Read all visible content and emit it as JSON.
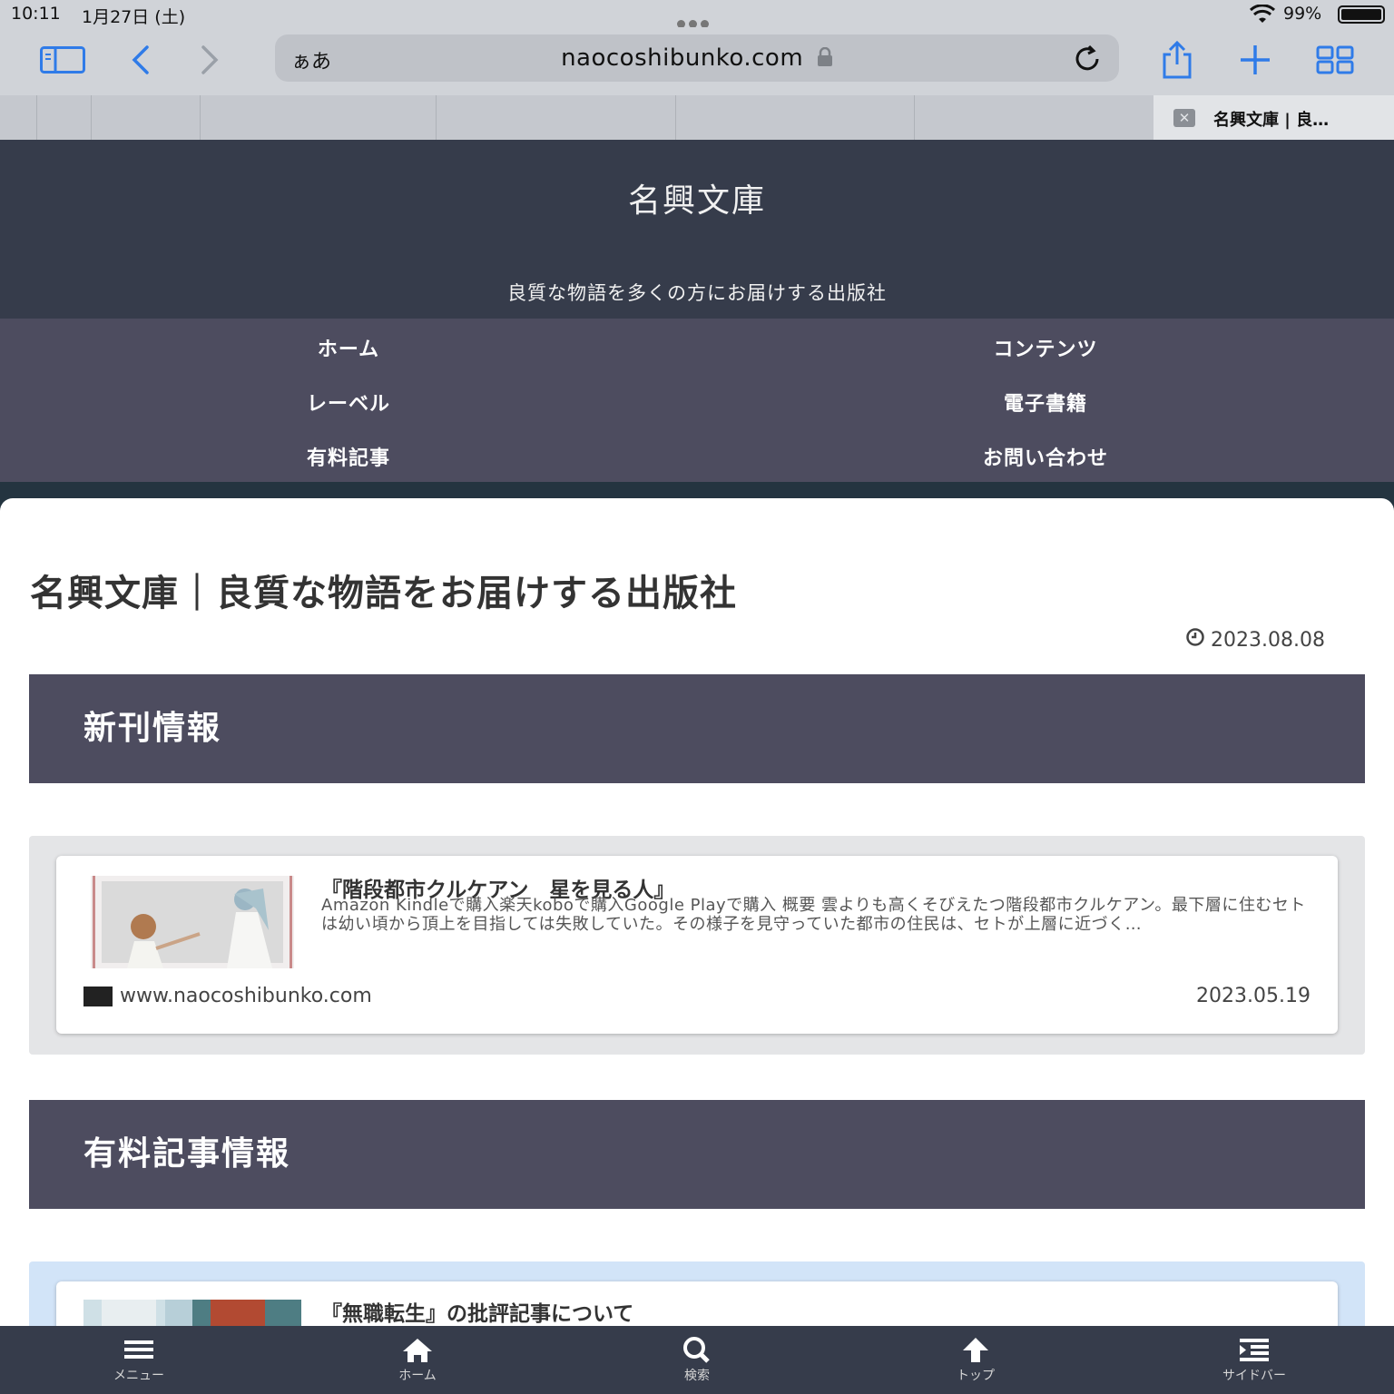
{
  "status_bar": {
    "time": "10:11",
    "date": "1月27日 (土)",
    "battery": "99%"
  },
  "browser": {
    "reader_label": "ぁあ",
    "url": "naocoshibunko.com",
    "tab_title": "名興文庫 | 良…"
  },
  "site": {
    "title": "名興文庫",
    "tagline": "良質な物語を多くの方にお届けする出版社",
    "nav": [
      "ホーム",
      "コンテンツ",
      "レーベル",
      "電子書籍",
      "有料記事",
      "お問い合わせ"
    ]
  },
  "page": {
    "title": "名興文庫｜良質な物語をお届けする出版社",
    "date": "2023.08.08"
  },
  "sections": [
    {
      "heading": "新刊情報",
      "card": {
        "title": "『階段都市クルケアン　星を見る人』",
        "excerpt": "Amazon Kindleで購入楽天koboで購入Google Playで購入 概要 雲よりも高くそびえたつ階段都市クルケアン。最下層に住むセトは幼い頃から頂上を目指しては失敗していた。その様子を見守っていた都市の住民は、セトが上層に近づく…",
        "site": "www.naocoshibunko.com",
        "date": "2023.05.19"
      }
    },
    {
      "heading": "有料記事情報",
      "card": {
        "title": "『無職転生』の批評記事について"
      }
    }
  ],
  "bottom_nav": [
    "メニュー",
    "ホーム",
    "検索",
    "トップ",
    "サイドバー"
  ],
  "colors": {
    "header_bg": "#363c4b",
    "nav_bg": "#4d4c5f",
    "section_bg": "#4d4c5f",
    "accent_blue": "#2f7be8"
  }
}
